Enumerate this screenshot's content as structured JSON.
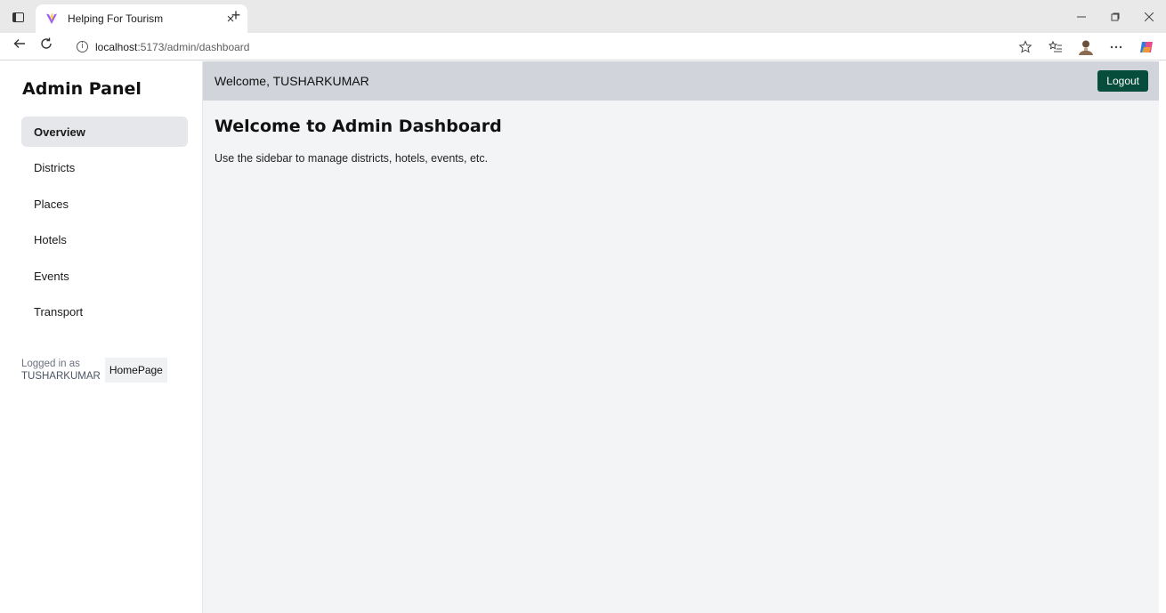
{
  "browser": {
    "tab_title": "Helping For Tourism",
    "tab_close_glyph": "×",
    "new_tab_glyph": "+",
    "url_host": "localhost",
    "url_path": ":5173/admin/dashboard",
    "icons": [
      "sidebar-toggle-icon",
      "vite-favicon",
      "back-arrow-icon",
      "refresh-icon",
      "info-icon",
      "favorite-star-icon",
      "favorites-list-icon",
      "profile-avatar",
      "more-icon",
      "copilot-icon"
    ]
  },
  "sidebar": {
    "title": "Admin Panel",
    "items": [
      {
        "label": "Overview",
        "active": true
      },
      {
        "label": "Districts"
      },
      {
        "label": "Places"
      },
      {
        "label": "Hotels"
      },
      {
        "label": "Events"
      },
      {
        "label": "Transport"
      }
    ],
    "logged_in_label": "Logged in as",
    "username": "TUSHARKUMAR",
    "homepage_label": "HomePage"
  },
  "header": {
    "welcome": "Welcome, TUSHARKUMAR",
    "logout_label": "Logout"
  },
  "main": {
    "title": "Welcome to Admin Dashboard",
    "description": "Use the sidebar to manage districts, hotels, events, etc."
  },
  "colors": {
    "topbar_bg": "#d1d5db",
    "main_bg": "#f3f4f6",
    "logout_bg": "#064e3b",
    "active_item_bg": "#e5e7eb"
  }
}
